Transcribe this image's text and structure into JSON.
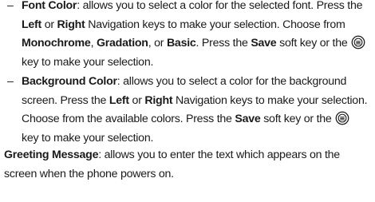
{
  "font_color": {
    "title": "Font Color",
    "l1_text": ": allows you to select a color for the selected font. Press the",
    "l2_left": "Left",
    "l2_or": " or ",
    "l2_right": "Right",
    "l2_text": " Navigation keys to make your selection. Choose from",
    "l3_opt1": "Monochrome",
    "l3_sep1": ", ",
    "l3_opt2": "Gradation",
    "l3_sep2": ", or ",
    "l3_opt3": "Basic",
    "l3_text1": ". Press the ",
    "l3_save": "Save",
    "l3_text2": " soft key or the",
    "l4_text": "key to make your selection."
  },
  "background_color": {
    "title": "Background Color",
    "l1_text": ": allows you to select a color for the background",
    "l2_text": "screen. Press the ",
    "l2_left": "Left",
    "l2_or": " or ",
    "l2_right": "Right",
    "l2_text2": " Navigation keys to make your selection.",
    "l3_text1": "Choose from the available colors. Press the ",
    "l3_save": "Save",
    "l3_text2": " soft key or the",
    "l4_text": "key to make your selection."
  },
  "greeting_message": {
    "title": "Greeting Message",
    "l1_text": ": allows you to enter the text which appears on the",
    "l2_text": "screen when the phone powers on."
  },
  "icons": {
    "ok_key": "ok-key-icon"
  }
}
